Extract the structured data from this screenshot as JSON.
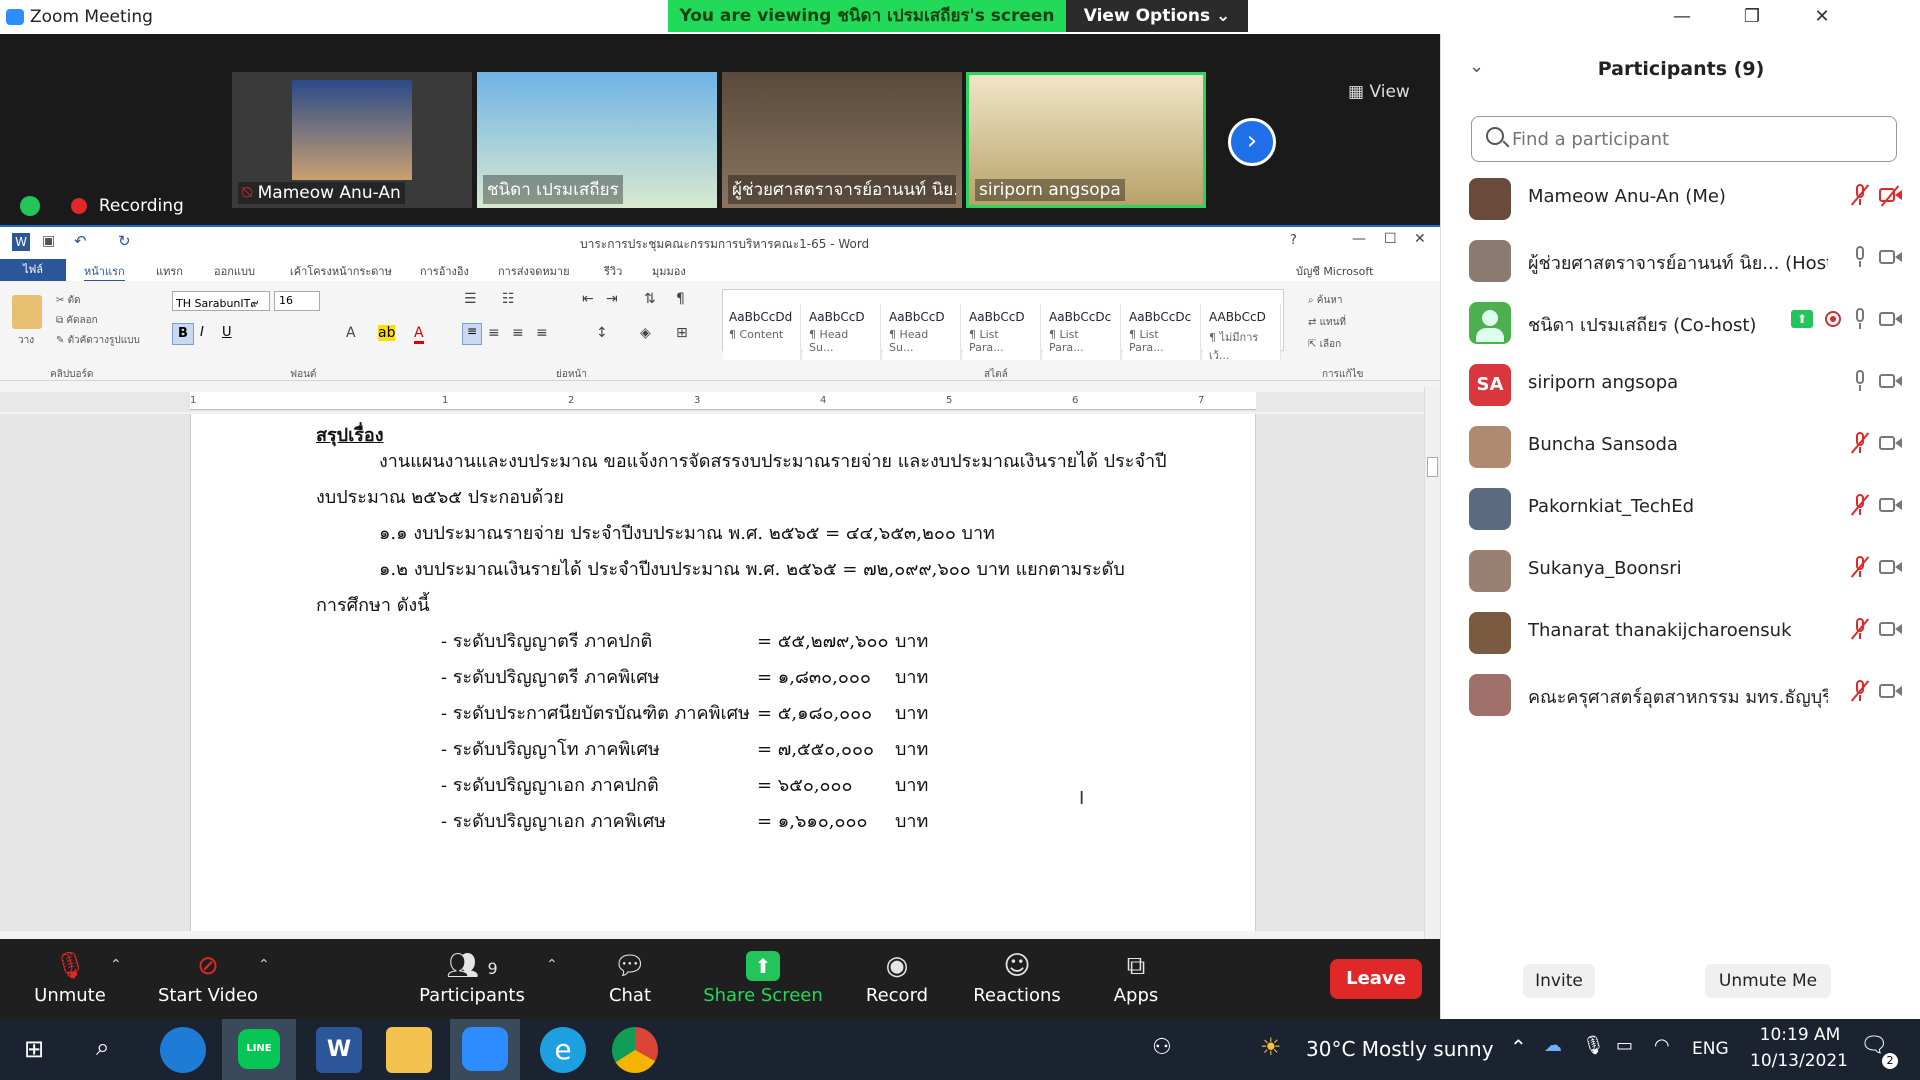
{
  "window": {
    "title": "Zoom Meeting"
  },
  "banner": {
    "viewing": "You are viewing ชนิดา เปรมเสถียร's screen",
    "view_options": "View Options ⌄"
  },
  "gallery": {
    "view_label": "View",
    "tiles": [
      {
        "name": "Mameow Anu-An",
        "muted": true
      },
      {
        "name": "ชนิดา เปรมเสถียร",
        "muted": false
      },
      {
        "name": "ผู้ช่วยศาสตราจารย์อานนท์ นิย...",
        "muted": false
      },
      {
        "name": "siriporn angsopa",
        "muted": false
      }
    ],
    "recording_label": "Recording"
  },
  "word": {
    "doc_title": "บาระการประชุมคณะกรรมการบริหารคณะ1-65 - Word",
    "file_tab": "ไฟล์",
    "tabs": [
      "หน้าแรก",
      "แทรก",
      "ออกแบบ",
      "เค้าโครงหน้ากระดาษ",
      "การอ้างอิง",
      "การส่งจดหมาย",
      "รีวิว",
      "มุมมอง"
    ],
    "account": "บัญชี Microsoft",
    "font_name": "TH SarabunIT๙",
    "font_size": "16",
    "group_labels": [
      "คลิปบอร์ด",
      "ฟอนต์",
      "ย่อหน้า",
      "สไตล์",
      "การแก้ไข"
    ],
    "clipboard": [
      "ตัด",
      "คัดลอก",
      "ตัวคัดวางรูปแบบ",
      "วาง"
    ],
    "editing": [
      "ค้นหา",
      "แทนที่",
      "เลือก"
    ],
    "styles": [
      {
        "preview": "AaBbCcDd",
        "name": "¶ Content"
      },
      {
        "preview": "AaBbCcD",
        "name": "¶ Head Su..."
      },
      {
        "preview": "AaBbCcD",
        "name": "¶ Head Su..."
      },
      {
        "preview": "AaBbCcD",
        "name": "¶ List Para..."
      },
      {
        "preview": "AaBbCcDc",
        "name": "¶ List Para..."
      },
      {
        "preview": "AaBbCcDc",
        "name": "¶ List Para..."
      },
      {
        "preview": "AABbCcD",
        "name": "¶ ไม่มีการเว้..."
      }
    ],
    "ruler_marks": [
      "1",
      "1",
      "2",
      "3",
      "4",
      "5",
      "6",
      "7"
    ],
    "doc_lines": [
      "สรุปเรื่อง",
      "งานแผนงานและงบประมาณ ขอแจ้งการจัดสรรงบประมาณรายจ่าย และงบประมาณเงินรายได้ ประจำปี",
      "งบประมาณ ๒๕๖๕ ประกอบด้วย",
      "๑.๑  งบประมาณรายจ่าย ประจำปีงบประมาณ พ.ศ. ๒๕๖๕  = ๔๔,๖๕๓,๒๐๐ บาท",
      "๑.๒  งบประมาณเงินรายได้ ประจำปีงบประมาณ พ.ศ. ๒๕๖๕ = ๗๒,๐๙๙,๖๐๐ บาท แยกตามระดับ",
      "การศึกษา ดังนี้"
    ],
    "budget_items": [
      {
        "label": "-  ระดับปริญญาตรี ภาคปกติ",
        "eq": "= ๕๕,๒๗๙,๖๐๐",
        "unit": "บาท"
      },
      {
        "label": "-  ระดับปริญญาตรี ภาคพิเศษ",
        "eq": "=   ๑,๘๓๐,๐๐๐",
        "unit": "บาท"
      },
      {
        "label": "-  ระดับประกาศนียบัตรบัณฑิต ภาคพิเศษ",
        "eq": "=   ๕,๑๘๐,๐๐๐",
        "unit": "บาท"
      },
      {
        "label": "-  ระดับปริญญาโท ภาคพิเศษ",
        "eq": "=   ๗,๕๕๐,๐๐๐",
        "unit": "บาท"
      },
      {
        "label": "-  ระดับปริญญาเอก ภาคปกติ",
        "eq": "=      ๖๕๐,๐๐๐",
        "unit": "บาท"
      },
      {
        "label": "-  ระดับปริญญาเอก ภาคพิเศษ",
        "eq": "=   ๑,๖๑๐,๐๐๐",
        "unit": "บาท"
      }
    ]
  },
  "toolbar": {
    "unmute": "Unmute",
    "start_video": "Start Video",
    "participants": "Participants",
    "participants_count": "9",
    "chat": "Chat",
    "share_screen": "Share Screen",
    "record": "Record",
    "reactions": "Reactions",
    "apps": "Apps",
    "leave": "Leave"
  },
  "panel": {
    "title": "Participants (9)",
    "search_placeholder": "Find a participant",
    "participants": [
      {
        "name": "Mameow Anu-An (Me)",
        "initials": "",
        "avatar_color": "#6a4a3a",
        "mic": "muted",
        "cam": "off"
      },
      {
        "name": "ผู้ช่วยศาสตราจารย์อานนท์ นิย... (Host)",
        "initials": "",
        "avatar_color": "#8a7a70",
        "mic": "on",
        "cam": "on"
      },
      {
        "name": "ชนิดา เปรมเสถียร (Co-host)",
        "initials": "",
        "avatar_color": "#4caf50",
        "mic": "on",
        "cam": "on",
        "sharing": true,
        "recording": true
      },
      {
        "name": "siriporn angsopa",
        "initials": "SA",
        "avatar_color": "#d9363e",
        "mic": "on",
        "cam": "on"
      },
      {
        "name": "Buncha Sansoda",
        "initials": "",
        "avatar_color": "#b08a70",
        "mic": "muted",
        "cam": "on"
      },
      {
        "name": "Pakornkiat_TechEd",
        "initials": "",
        "avatar_color": "#5a6a80",
        "mic": "muted",
        "cam": "on"
      },
      {
        "name": "Sukanya_Boonsri",
        "initials": "",
        "avatar_color": "#9a8070",
        "mic": "muted",
        "cam": "on"
      },
      {
        "name": "Thanarat thanakijcharoensuk",
        "initials": "",
        "avatar_color": "#7a5a40",
        "mic": "muted",
        "cam": "on"
      },
      {
        "name": "คณะครุศาสตร์อุตสาหกรรม มทร.ธัญบุรี",
        "initials": "",
        "avatar_color": "#a0706a",
        "mic": "muted",
        "cam": "on"
      }
    ],
    "invite": "Invite",
    "unmute_me": "Unmute Me"
  },
  "taskbar": {
    "weather": "30°C  Mostly sunny",
    "lang": "ENG",
    "time": "10:19 AM",
    "date": "10/13/2021",
    "notif_count": "2"
  }
}
